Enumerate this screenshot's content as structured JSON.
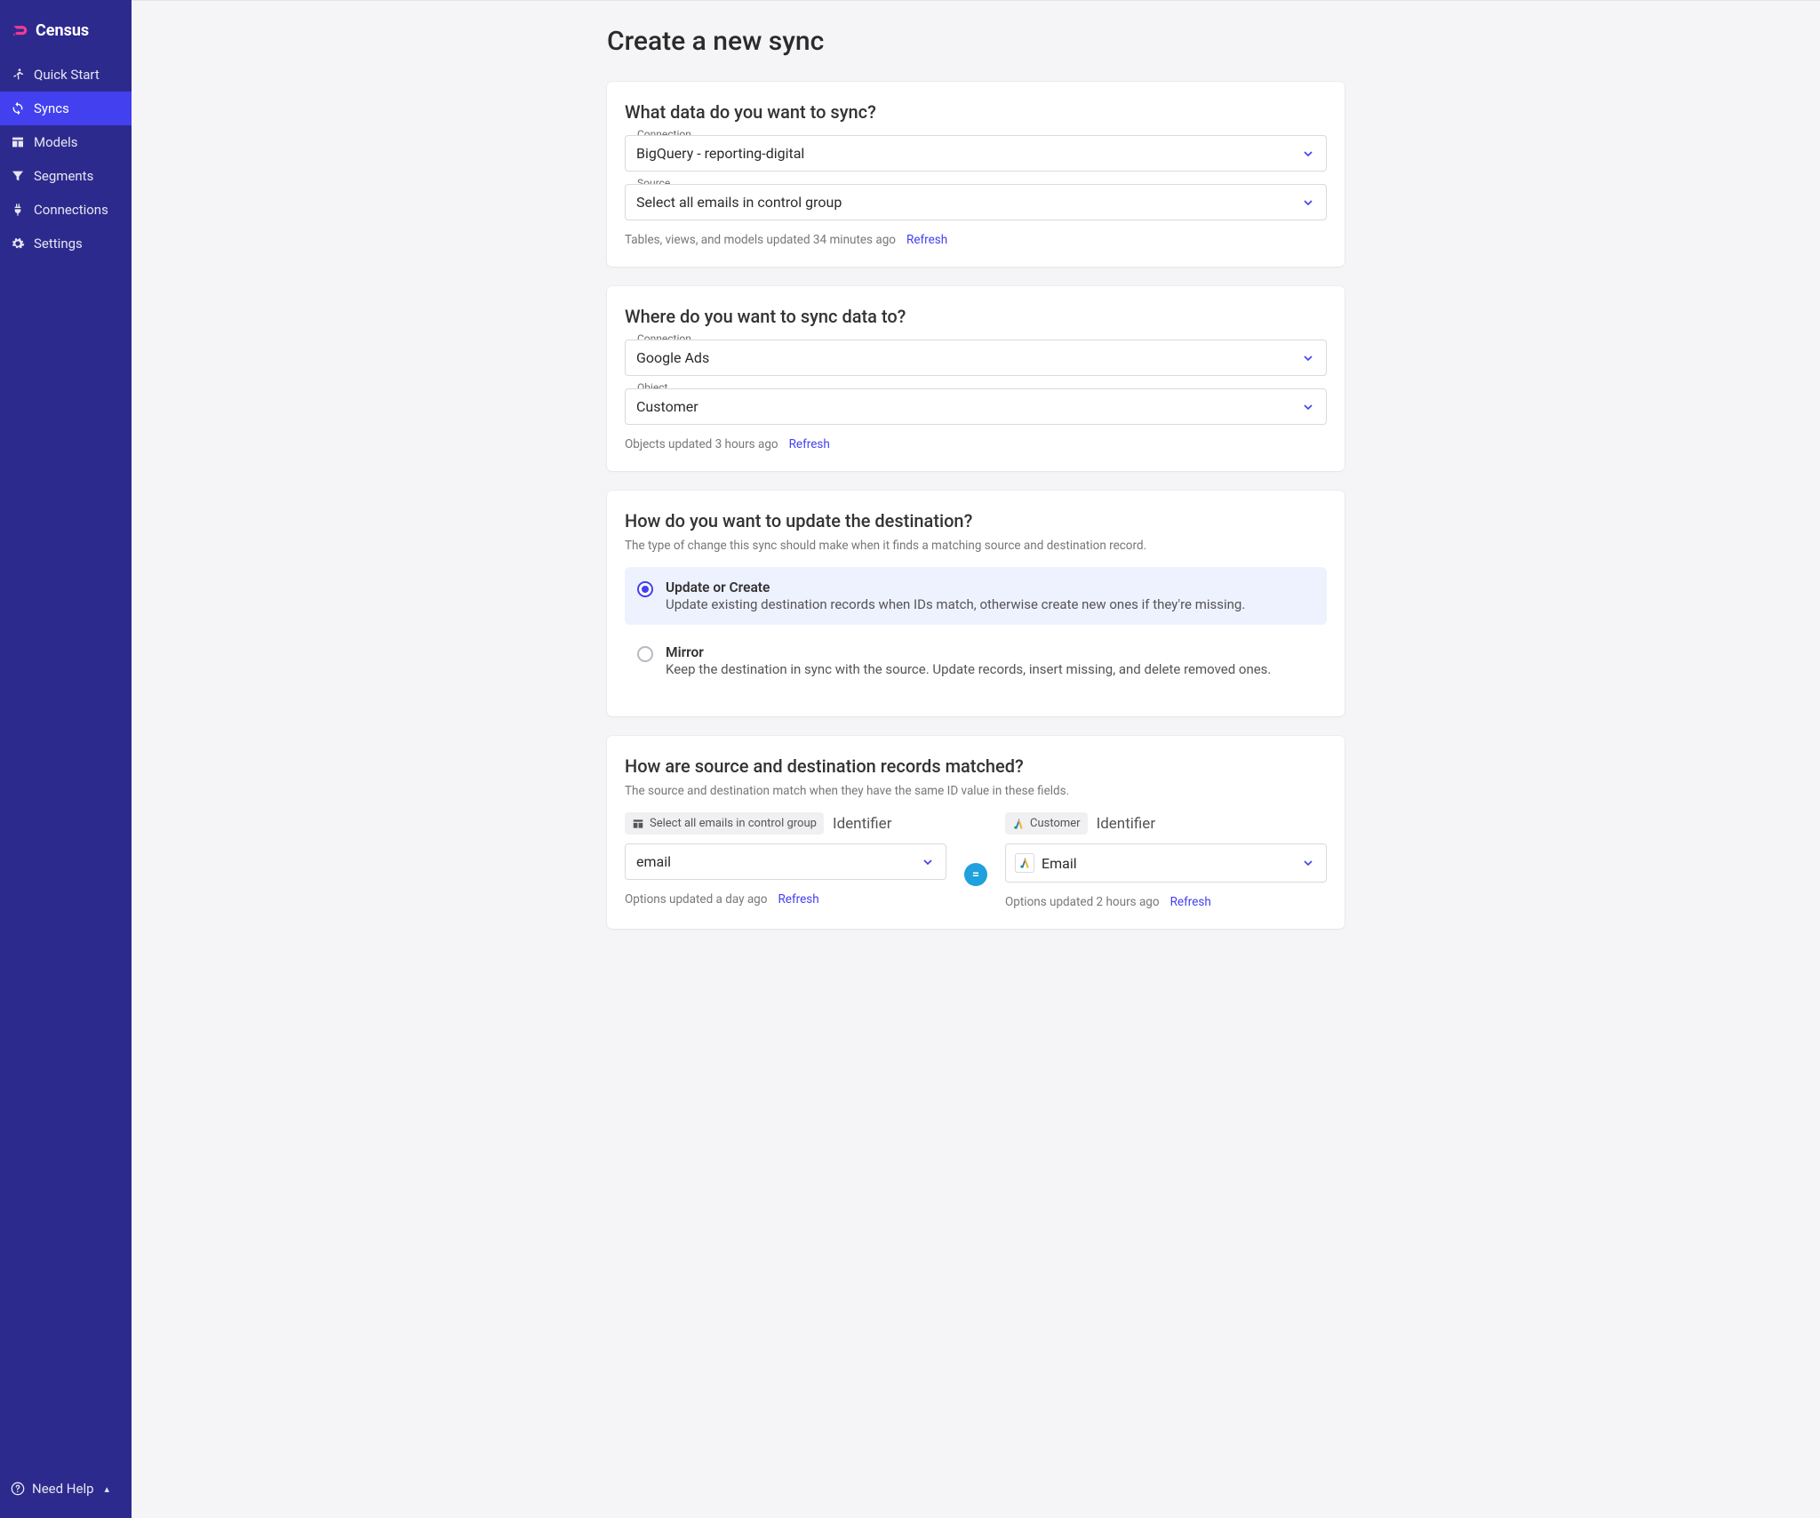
{
  "brand": {
    "name": "Census"
  },
  "sidebar": {
    "items": [
      {
        "label": "Quick Start",
        "icon": "running-icon",
        "active": false
      },
      {
        "label": "Syncs",
        "icon": "sync-icon",
        "active": true
      },
      {
        "label": "Models",
        "icon": "table-icon",
        "active": false
      },
      {
        "label": "Segments",
        "icon": "filter-icon",
        "active": false
      },
      {
        "label": "Connections",
        "icon": "plug-icon",
        "active": false
      },
      {
        "label": "Settings",
        "icon": "gear-icon",
        "active": false
      }
    ],
    "help_label": "Need Help",
    "help_caret": "▴"
  },
  "page": {
    "title": "Create a new sync"
  },
  "source_card": {
    "title": "What data do you want to sync?",
    "connection_label": "Connection",
    "connection_value": "BigQuery - reporting-digital",
    "source_label": "Source",
    "source_value": "Select all emails in control group",
    "meta_text": "Tables, views, and models updated 34 minutes ago",
    "refresh_label": "Refresh"
  },
  "dest_card": {
    "title": "Where do you want to sync data to?",
    "connection_label": "Connection",
    "connection_value": "Google Ads",
    "object_label": "Object",
    "object_value": "Customer",
    "meta_text": "Objects updated 3 hours ago",
    "refresh_label": "Refresh"
  },
  "behavior_card": {
    "title": "How do you want to update the destination?",
    "subtitle": "The type of change this sync should make when it finds a matching source and destination record.",
    "options": [
      {
        "title": "Update or Create",
        "desc": "Update existing destination records when IDs match, otherwise create new ones if they're missing.",
        "selected": true
      },
      {
        "title": "Mirror",
        "desc": "Keep the destination in sync with the source. Update records, insert missing, and delete removed ones.",
        "selected": false
      }
    ]
  },
  "match_card": {
    "title": "How are source and destination records matched?",
    "subtitle": "The source and destination match when they have the same ID value in these fields.",
    "equals": "=",
    "source": {
      "pill_text": "Select all emails in control group",
      "identifier_label": "Identifier",
      "select_value": "email",
      "meta_text": "Options updated a day ago",
      "refresh_label": "Refresh"
    },
    "destination": {
      "pill_text": "Customer",
      "identifier_label": "Identifier",
      "select_value": "Email",
      "meta_text": "Options updated 2 hours ago",
      "refresh_label": "Refresh"
    }
  }
}
